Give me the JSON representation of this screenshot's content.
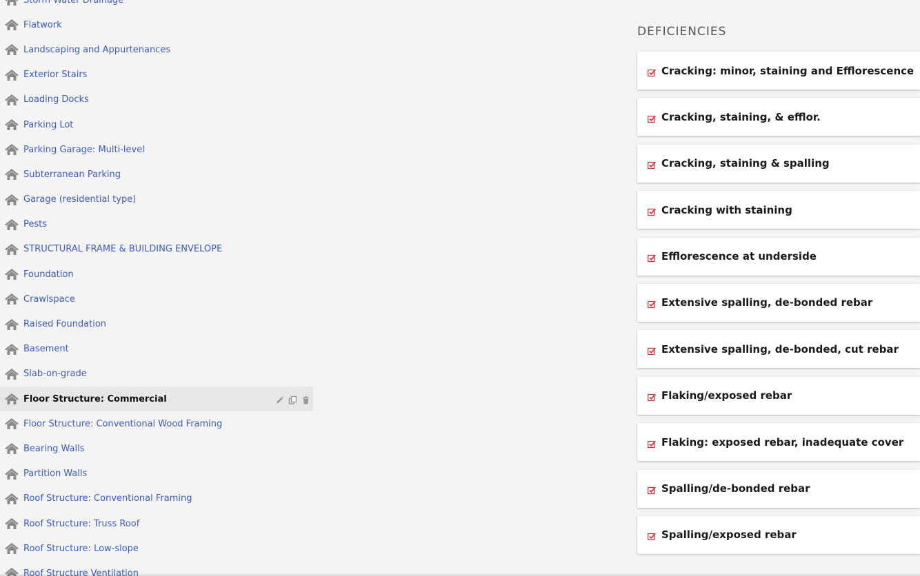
{
  "sidebar": {
    "items": [
      {
        "label": "Storm Water Drainage",
        "active": false
      },
      {
        "label": "Flatwork",
        "active": false
      },
      {
        "label": "Landscaping and Appurtenances",
        "active": false
      },
      {
        "label": "Exterior Stairs",
        "active": false
      },
      {
        "label": "Loading Docks",
        "active": false
      },
      {
        "label": "Parking Lot",
        "active": false
      },
      {
        "label": "Parking Garage: Multi-level",
        "active": false
      },
      {
        "label": "Subterranean Parking",
        "active": false
      },
      {
        "label": "Garage (residential type)",
        "active": false
      },
      {
        "label": "Pests",
        "active": false
      },
      {
        "label": "STRUCTURAL FRAME & BUILDING ENVELOPE",
        "active": false
      },
      {
        "label": "Foundation",
        "active": false
      },
      {
        "label": "Crawlspace",
        "active": false
      },
      {
        "label": "Raised Foundation",
        "active": false
      },
      {
        "label": "Basement",
        "active": false
      },
      {
        "label": "Slab-on-grade",
        "active": false
      },
      {
        "label": "Floor Structure: Commercial",
        "active": true
      },
      {
        "label": "Floor Structure: Conventional Wood Framing",
        "active": false
      },
      {
        "label": "Bearing Walls",
        "active": false
      },
      {
        "label": "Partition Walls",
        "active": false
      },
      {
        "label": "Roof Structure: Conventional Framing",
        "active": false
      },
      {
        "label": "Roof Structure: Truss Roof",
        "active": false
      },
      {
        "label": "Roof Structure: Low-slope",
        "active": false
      },
      {
        "label": "Roof Structure Ventilation",
        "active": false
      }
    ],
    "item_icon": "house-icon",
    "active_actions": [
      "pencil-icon",
      "copy-icon",
      "trash-icon"
    ]
  },
  "deficiencies": {
    "title": "DEFICIENCIES",
    "items": [
      "Cracking: minor, staining and Efflorescence",
      "Cracking, staining, & efflor.",
      "Cracking, staining & spalling",
      "Cracking with staining",
      "Efflorescence at underside",
      "Extensive spalling, de-bonded rebar",
      "Extensive spalling, de-bonded, cut rebar",
      "Flaking/exposed rebar",
      "Flaking: exposed rebar, inadequate cover",
      "Spalling/de-bonded rebar",
      "Spalling/exposed rebar"
    ],
    "item_icon": "checkbox-checked-icon"
  },
  "colors": {
    "link": "#3b5bc6",
    "icon_gray": "#8a8a8a",
    "check_red": "#d9343a",
    "active_bg": "#e7e7e7",
    "page_bg": "#f4f4f4"
  }
}
